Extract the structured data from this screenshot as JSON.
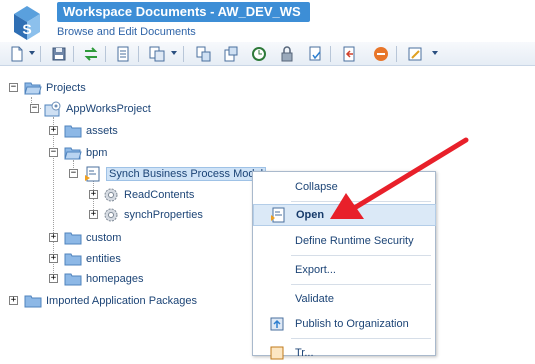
{
  "header": {
    "title": "Workspace Documents - AW_DEV_WS",
    "subtitle": "Browse and Edit Documents",
    "logo_icon": "appworks-logo-icon"
  },
  "toolbar": {
    "buttons": [
      "new-document-icon",
      "save-icon",
      "sync-icon",
      "properties-icon",
      "copy-icon",
      "import-icon",
      "export-icon",
      "history-icon",
      "lock-icon",
      "check-in-icon",
      "close-document-icon",
      "stop-icon",
      "edit-icon"
    ]
  },
  "tree": {
    "projects": "Projects",
    "appworks_project": "AppWorksProject",
    "assets": "assets",
    "bpm": "bpm",
    "synch_model": "Synch Business Process Model",
    "read_contents": "ReadContents",
    "synch_properties": "synchProperties",
    "custom": "custom",
    "entities": "entities",
    "homepages": "homepages",
    "imported_packages": "Imported Application Packages"
  },
  "context_menu": {
    "collapse": "Collapse",
    "open": "Open",
    "define_runtime_security": "Define Runtime Security",
    "export": "Export...",
    "validate": "Validate",
    "publish": "Publish to Organization",
    "partial_item": "Tr..."
  },
  "colors": {
    "title_bar": "#3d8ed6",
    "folder": "#5b9bd5",
    "arrow": "#e8202a"
  }
}
